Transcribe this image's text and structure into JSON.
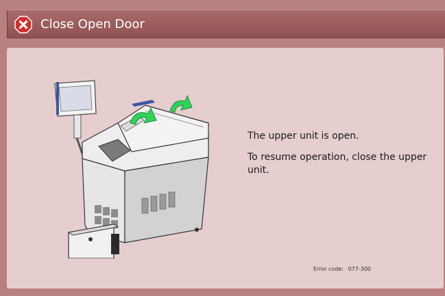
{
  "dialog": {
    "title": "Close Open Door",
    "icon": "error-x-icon",
    "title_bar_color": "#9a5b5b",
    "panel_color": "#e6cece"
  },
  "message": {
    "line1": "The upper unit is open.",
    "line2": "To resume operation, close the upper unit."
  },
  "error": {
    "label": "Error code:",
    "code": "077-300"
  },
  "illustration": {
    "icon": "printer-upper-unit-open-illustration",
    "arrow_color": "#2fd35a"
  }
}
